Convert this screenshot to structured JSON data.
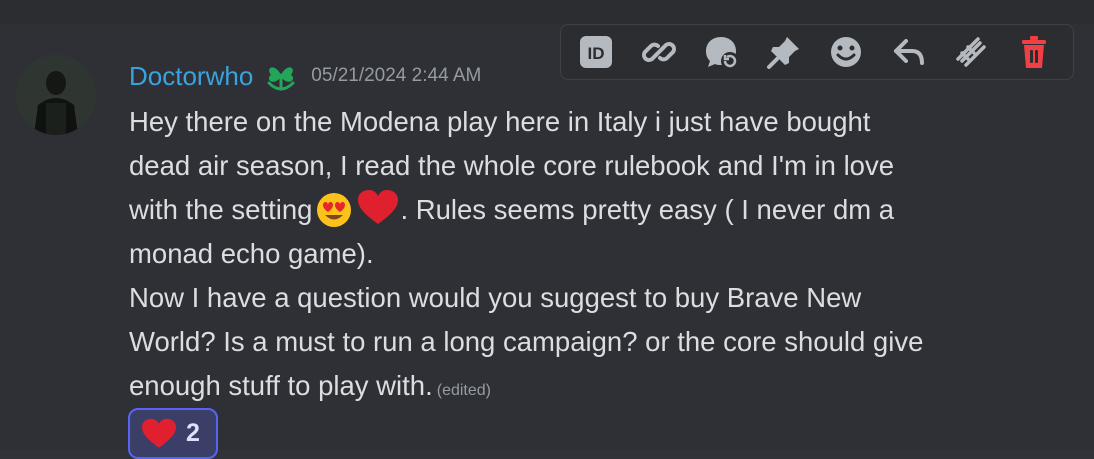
{
  "message": {
    "author": "Doctorwho",
    "timestamp": "05/21/2024 2:44 AM",
    "role_icon": "clover-leaf-icon",
    "lines": [
      {
        "before": "Hey there on the Modena play here in Italy i just have bought",
        "after": ""
      },
      {
        "before": "dead air season, I read the whole core rulebook and I'm in love",
        "after": ""
      },
      {
        "before": "with the setting",
        "emojis": [
          "heart-eyes-emoji",
          "red-heart-emoji"
        ],
        "after": ". Rules seems pretty easy ( I never dm a"
      },
      {
        "before": "monad echo game).",
        "after": ""
      },
      {
        "before": "Now I have a question would you suggest to buy Brave New",
        "after": ""
      },
      {
        "before": "World? Is a must to run a long campaign? or the core should give",
        "after": ""
      },
      {
        "before": "enough stuff to play with.",
        "after": ""
      }
    ],
    "edited_label": "(edited)",
    "reaction": {
      "emoji": "red-heart-emoji",
      "count": "2"
    }
  },
  "toolbar": {
    "items": [
      "copy-id-icon",
      "copy-link-icon",
      "create-thread-icon",
      "pin-icon",
      "add-reaction-icon",
      "reply-icon",
      "mark-unread-icon",
      "delete-icon"
    ]
  },
  "colors": {
    "background": "#2e3035",
    "username": "#3aa3de",
    "timestamp": "#949ba4",
    "text": "#dbdee1",
    "toolbar_bg": "#2b2d31",
    "delete": "#f23f43",
    "reaction_border": "#5865f2",
    "reaction_bg": "#3b3e66",
    "role_icon": "#23a55a"
  }
}
